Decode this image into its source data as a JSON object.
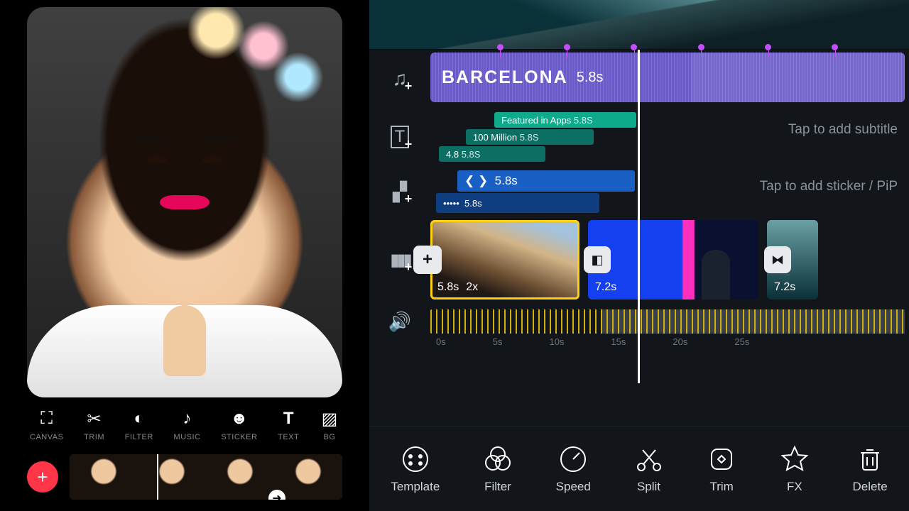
{
  "left": {
    "tools": {
      "canvas": "CANVAS",
      "trim": "TRIM",
      "filter": "FILTER",
      "music": "MUSIC",
      "sticker": "STICKER",
      "text": "TEXT",
      "bg": "BG"
    },
    "add_label": "+"
  },
  "timeline": {
    "audio": {
      "title": "BARCELONA",
      "duration": "5.8s"
    },
    "text": {
      "featured": "Featured in Apps",
      "featured_dur": "5.8S",
      "million": "100 Million",
      "million_dur": "5.8S",
      "rating": "4.8",
      "rating_dur": "5.8S",
      "hint_subtitle": "Tap to add subtitle"
    },
    "sticker": {
      "a_label": "❮ ❯",
      "a_dur": "5.8s",
      "b_label": "•••••",
      "b_dur": "5.8s",
      "hint_sticker": "Tap to add sticker / PiP"
    },
    "video": {
      "clip1_dur": "5.8s",
      "clip1_speed": "2x",
      "clip2_dur": "7.2s",
      "clip3_dur": "7.2s",
      "insert": "+"
    },
    "ticks": {
      "t0": "0s",
      "t5": "5s",
      "t10": "10s",
      "t15": "15s",
      "t20": "20s",
      "t25": "25s"
    }
  },
  "actions": {
    "template": "Template",
    "filter": "Filter",
    "speed": "Speed",
    "split": "Split",
    "trim": "Trim",
    "fx": "FX",
    "delete": "Delete"
  }
}
